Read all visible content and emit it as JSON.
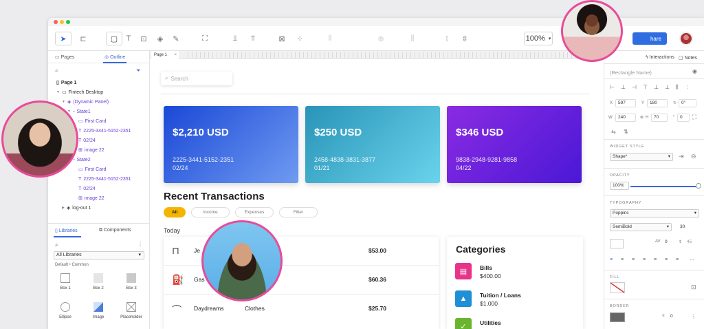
{
  "toolbar": {
    "zoom": "100%",
    "share_label": "hare",
    "colors": {
      "share": "#2f6de1"
    }
  },
  "left_panel": {
    "tabs": {
      "pages": "Pages",
      "outline": "Outline"
    },
    "tree": [
      {
        "label": "Page 1"
      },
      {
        "label": "Fintech Desktop"
      },
      {
        "label": "(Dynamic Panel)"
      },
      {
        "label": "State1"
      },
      {
        "label": "First Card"
      },
      {
        "label": "2225-3441-5152-2351"
      },
      {
        "label": "02/24"
      },
      {
        "label": "image 22"
      },
      {
        "label": "State2"
      },
      {
        "label": "First Card"
      },
      {
        "label": "2225-3441-5152-2351"
      },
      {
        "label": "02/24"
      },
      {
        "label": "image 22"
      },
      {
        "label": "log-out 1"
      }
    ],
    "libraries": {
      "tabs": {
        "libraries": "Libraries",
        "components": "Components"
      },
      "select": "All Libraries",
      "subtitle": "Default • Common",
      "items": [
        "Box 1",
        "Box 2",
        "Box 3",
        "Ellipse",
        "Image",
        "Placeholder"
      ]
    }
  },
  "canvas": {
    "page_tab": "Page 1",
    "search_placeholder": "Search",
    "cards": [
      {
        "amount": "$2,210 USD",
        "number": "2225-3441-5152-2351",
        "expiry": "02/24"
      },
      {
        "amount": "$250 USD",
        "number": "2458-4838-3831-3877",
        "expiry": "01/21"
      },
      {
        "amount": "$346 USD",
        "number": "9838-2948-9281-9858",
        "expiry": "04/22"
      }
    ],
    "recent_title": "Recent Transactions",
    "filters": [
      "All",
      "Income",
      "Expenses",
      "Filter"
    ],
    "today_label": "Today",
    "transactions": [
      {
        "name": "Je",
        "category": "ase",
        "amount": "$53.00"
      },
      {
        "name": "Gas",
        "category": "",
        "amount": "$60.36"
      },
      {
        "name": "Daydreams",
        "category": "Clothes",
        "amount": "$25.70"
      }
    ],
    "categories_title": "Categories",
    "categories": [
      {
        "name": "Bills",
        "amount": "$400.00",
        "color": "#e8338a"
      },
      {
        "name": "Tuition / Loans",
        "amount": "$1,000",
        "color": "#1f8fd6"
      },
      {
        "name": "Utilities",
        "amount": "",
        "color": "#6bb52e"
      }
    ]
  },
  "right_panel": {
    "tabs": {
      "interactions": "Interactions",
      "notes": "Notes"
    },
    "widget_name": "(Rectangle Name)",
    "x": "597",
    "y": "180",
    "rotation": "0°",
    "w": "240",
    "h": "70",
    "corner": "0",
    "widget_style_label": "WIDGET STYLE",
    "widget_style": "Shape*",
    "opacity_label": "OPACITY",
    "opacity": "100%",
    "typography_label": "TYPOGRAPHY",
    "font": "Poppins",
    "weight": "SemiBold",
    "font_size": "30",
    "letter_spacing": "0",
    "line_height": "45",
    "fill_label": "FILL",
    "border_label": "BORDER",
    "border_width": "0"
  }
}
